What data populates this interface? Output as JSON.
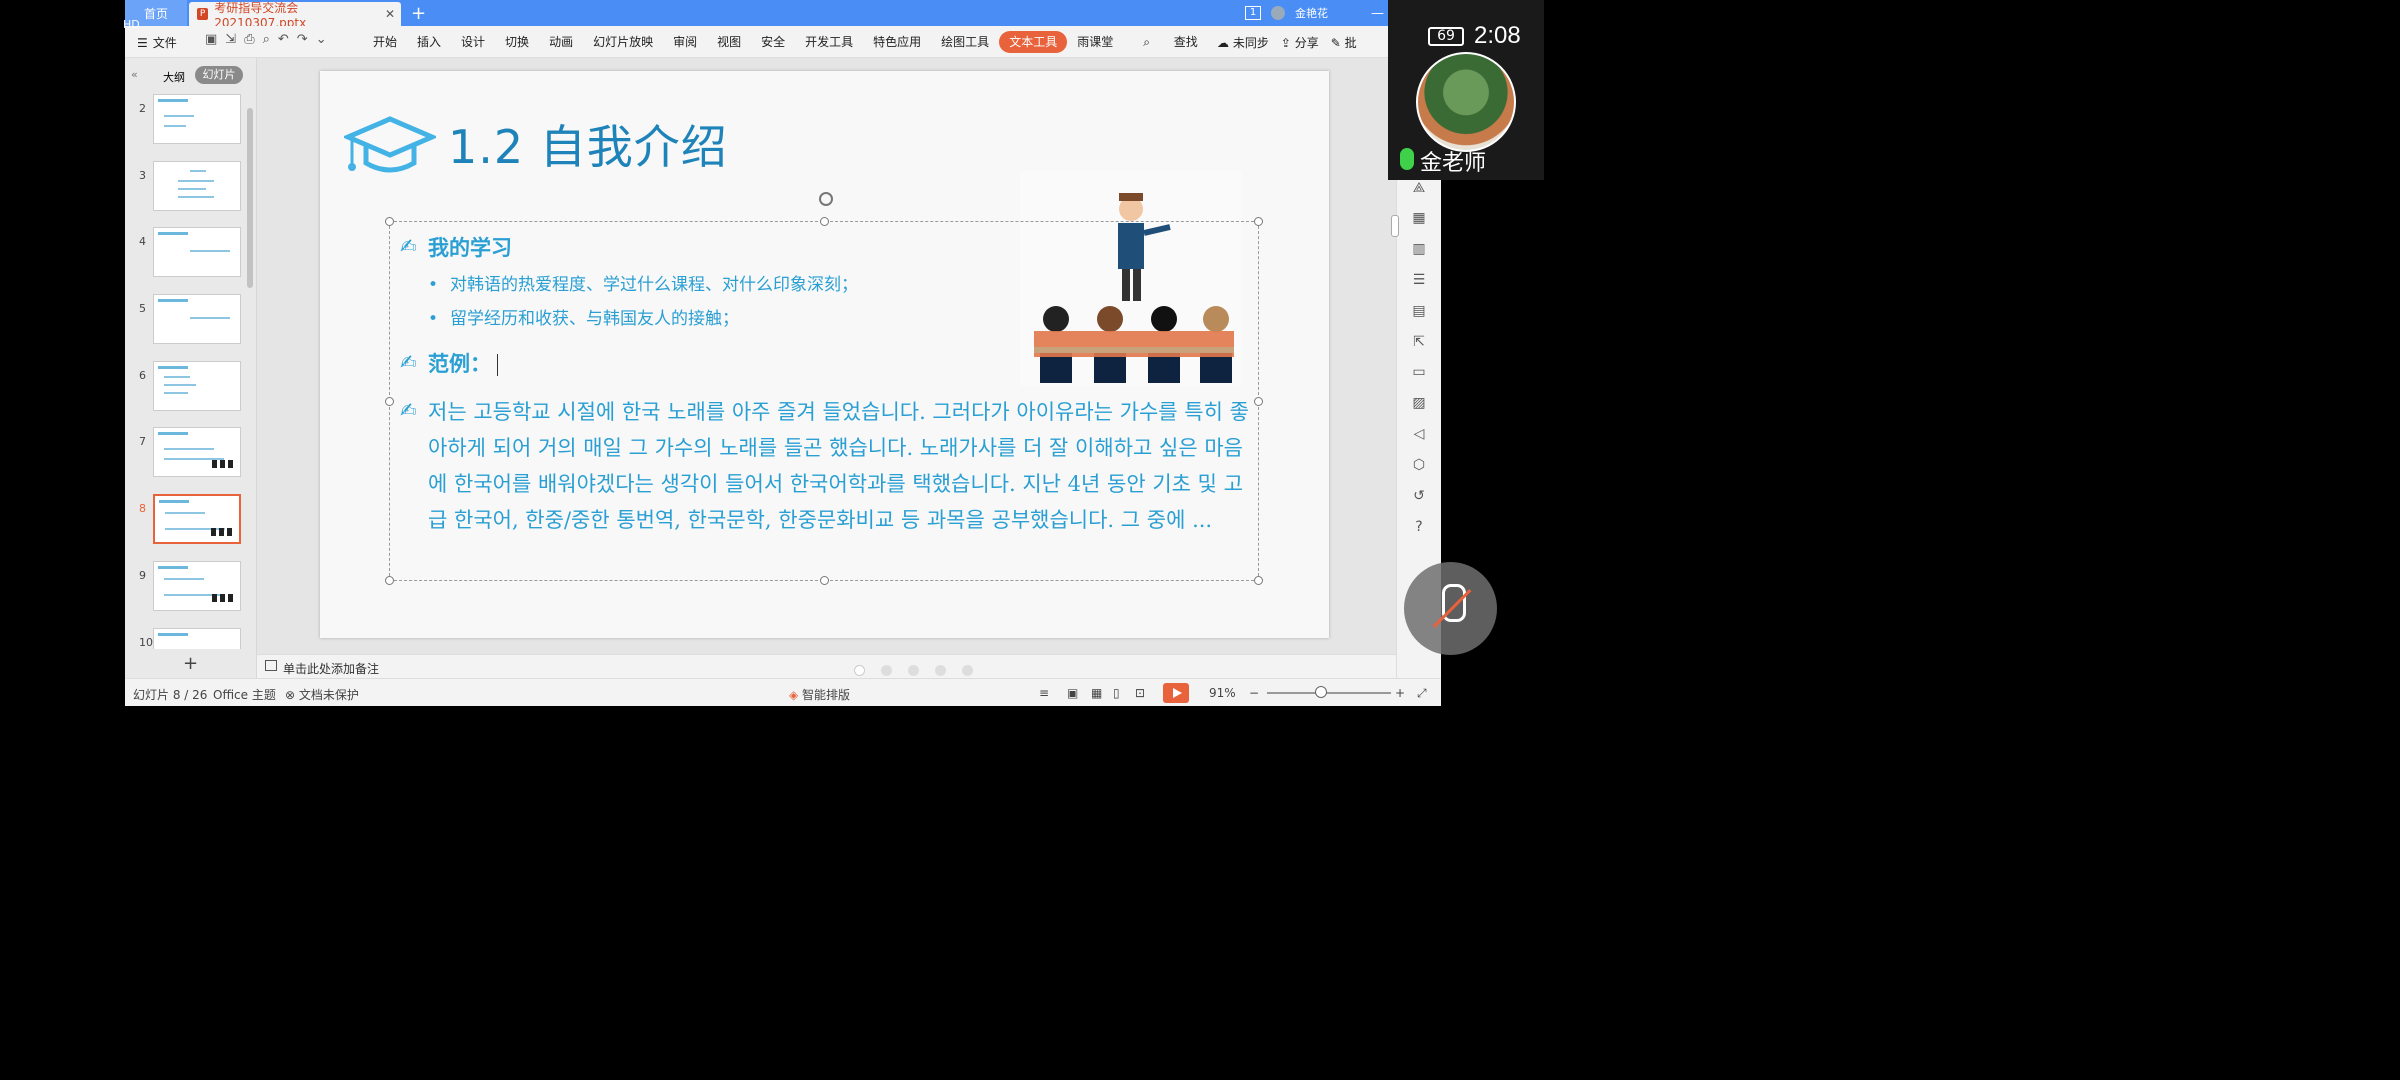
{
  "titlebar": {
    "home_tab": "首页",
    "doc_tab": "考研指导交流会20210307.pptx",
    "user_name": "金艳花",
    "badge": "1"
  },
  "ribbon": {
    "file": "文件",
    "menus": [
      "开始",
      "插入",
      "设计",
      "切换",
      "动画",
      "幻灯片放映",
      "审阅",
      "视图",
      "安全",
      "开发工具",
      "特色应用",
      "绘图工具",
      "文本工具",
      "雨课堂",
      "查找"
    ],
    "active_menu": "文本工具",
    "sync": "未同步",
    "share": "分享",
    "comment": "批"
  },
  "side": {
    "outline_tab": "大纲",
    "slides_tab": "幻灯片",
    "thumb_numbers": [
      "2",
      "3",
      "4",
      "5",
      "6",
      "7",
      "8",
      "9",
      "10"
    ],
    "selected": "8"
  },
  "slide": {
    "title": "1.2 自我介绍",
    "section1": "我的学习",
    "bullets": [
      "对韩语的热爱程度、学过什么课程、对什么印象深刻；",
      "留学经历和收获、与韩国友人的接触；"
    ],
    "section2": "范例：",
    "korean_text": "저는 고등학교 시절에 한국 노래를 아주 즐겨 들었습니다. 그러다가 아이유라는 가수를 특히 좋아하게 되어 거의 매일 그 가수의 노래를 들곤 했습니다. 노래가사를 더 잘 이해하고 싶은 마음에 한국어를 배워야겠다는 생각이 들어서 한국어학과를 택했습니다. 지난 4년 동안 기초 및 고급 한국어, 한중/중한 통번역, 한국문학, 한중문화비교 등 과목을 공부했습니다. 그 중에 ..."
  },
  "notes": {
    "placeholder": "单击此处添加备注"
  },
  "status": {
    "slide_counter": "幻灯片 8 / 26",
    "theme": "Office 主题",
    "protect": "文档未保护",
    "smart": "智能排版",
    "zoom": "91%"
  },
  "overlay": {
    "teacher_name": "金老师",
    "clock": "2:08",
    "battery": "69",
    "hd": "HD"
  },
  "colors": {
    "accent": "#e8623b",
    "slide_text": "#2a9fd3",
    "title_bar": "#4a8ef5"
  }
}
